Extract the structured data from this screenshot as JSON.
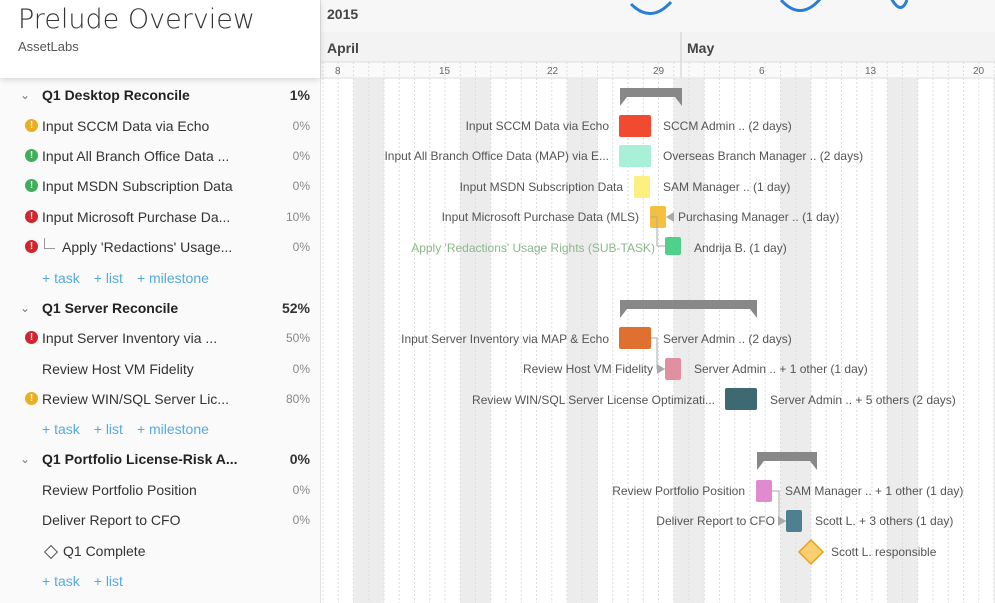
{
  "project": {
    "title": "Prelude Overview",
    "org": "AssetLabs"
  },
  "timeline": {
    "year": "2015",
    "months": [
      "April",
      "May"
    ],
    "days": [
      "8",
      "15",
      "22",
      "29",
      "6",
      "13",
      "20"
    ]
  },
  "groups": [
    {
      "name": "Q1 Desktop Reconcile",
      "pct": "1%",
      "tasks": [
        {
          "name": "Input SCCM Data via Echo",
          "pct": "0%",
          "status": "yellow",
          "bar_label": "Input SCCM Data via Echo",
          "assignee": "SCCM Admin .. (2 days)",
          "color": "#f04a30"
        },
        {
          "name": "Input All Branch Office Data ...",
          "pct": "0%",
          "status": "green",
          "bar_label": "Input All Branch Office Data (MAP) via E...",
          "assignee": "Overseas Branch Manager .. (2 days)",
          "color": "#a8f0d8"
        },
        {
          "name": "Input MSDN Subscription Data",
          "pct": "0%",
          "status": "green",
          "bar_label": "Input MSDN Subscription Data",
          "assignee": "SAM Manager .. (1 day)",
          "color": "#fbf080"
        },
        {
          "name": "Input Microsoft Purchase Da...",
          "pct": "10%",
          "status": "red",
          "bar_label": "Input Microsoft Purchase Data (MLS)",
          "assignee": "Purchasing Manager .. (1 day)",
          "color": "#f5c040"
        },
        {
          "name": "Apply 'Redactions' Usage...",
          "pct": "0%",
          "status": "red",
          "bar_label": "Apply 'Redactions' Usage Rights (SUB-TASK)",
          "assignee": "Andrija B. (1 day)",
          "color": "#50d08a"
        }
      ],
      "add": [
        "+ task",
        "+ list",
        "+ milestone"
      ]
    },
    {
      "name": "Q1 Server Reconcile",
      "pct": "52%",
      "tasks": [
        {
          "name": "Input Server Inventory via ...",
          "pct": "50%",
          "status": "red",
          "bar_label": "Input Server Inventory via MAP & Echo",
          "assignee": "Server Admin .. (2 days)",
          "color": "#e07030"
        },
        {
          "name": "Review Host VM Fidelity",
          "pct": "0%",
          "status": "",
          "bar_label": "Review Host VM Fidelity",
          "assignee": "Server Admin .. + 1 other (1 day)",
          "color": "#e090a0"
        },
        {
          "name": "Review WIN/SQL Server Lic...",
          "pct": "80%",
          "status": "yellow",
          "bar_label": "Review WIN/SQL Server License Optimizati...",
          "assignee": "Server Admin .. + 5 others (2 days)",
          "color": "#3e6872"
        }
      ],
      "add": [
        "+ task",
        "+ list",
        "+ milestone"
      ]
    },
    {
      "name": "Q1 Portfolio License-Risk A...",
      "pct": "0%",
      "tasks": [
        {
          "name": "Review Portfolio Position",
          "pct": "0%",
          "status": "",
          "bar_label": "Review Portfolio Position",
          "assignee": "SAM Manager .. + 1 other (1 day)",
          "color": "#e08ad0"
        },
        {
          "name": "Deliver Report to CFO",
          "pct": "0%",
          "status": "",
          "bar_label": "Deliver Report to CFO",
          "assignee": "Scott L. + 3 others (1 day)",
          "color": "#4f8090"
        },
        {
          "name": "Q1 Complete",
          "pct": "",
          "status": "milestone",
          "bar_label": "",
          "assignee": "Scott L. responsible",
          "color": "#f8d070"
        }
      ],
      "add": [
        "+ task",
        "+ list"
      ]
    }
  ]
}
